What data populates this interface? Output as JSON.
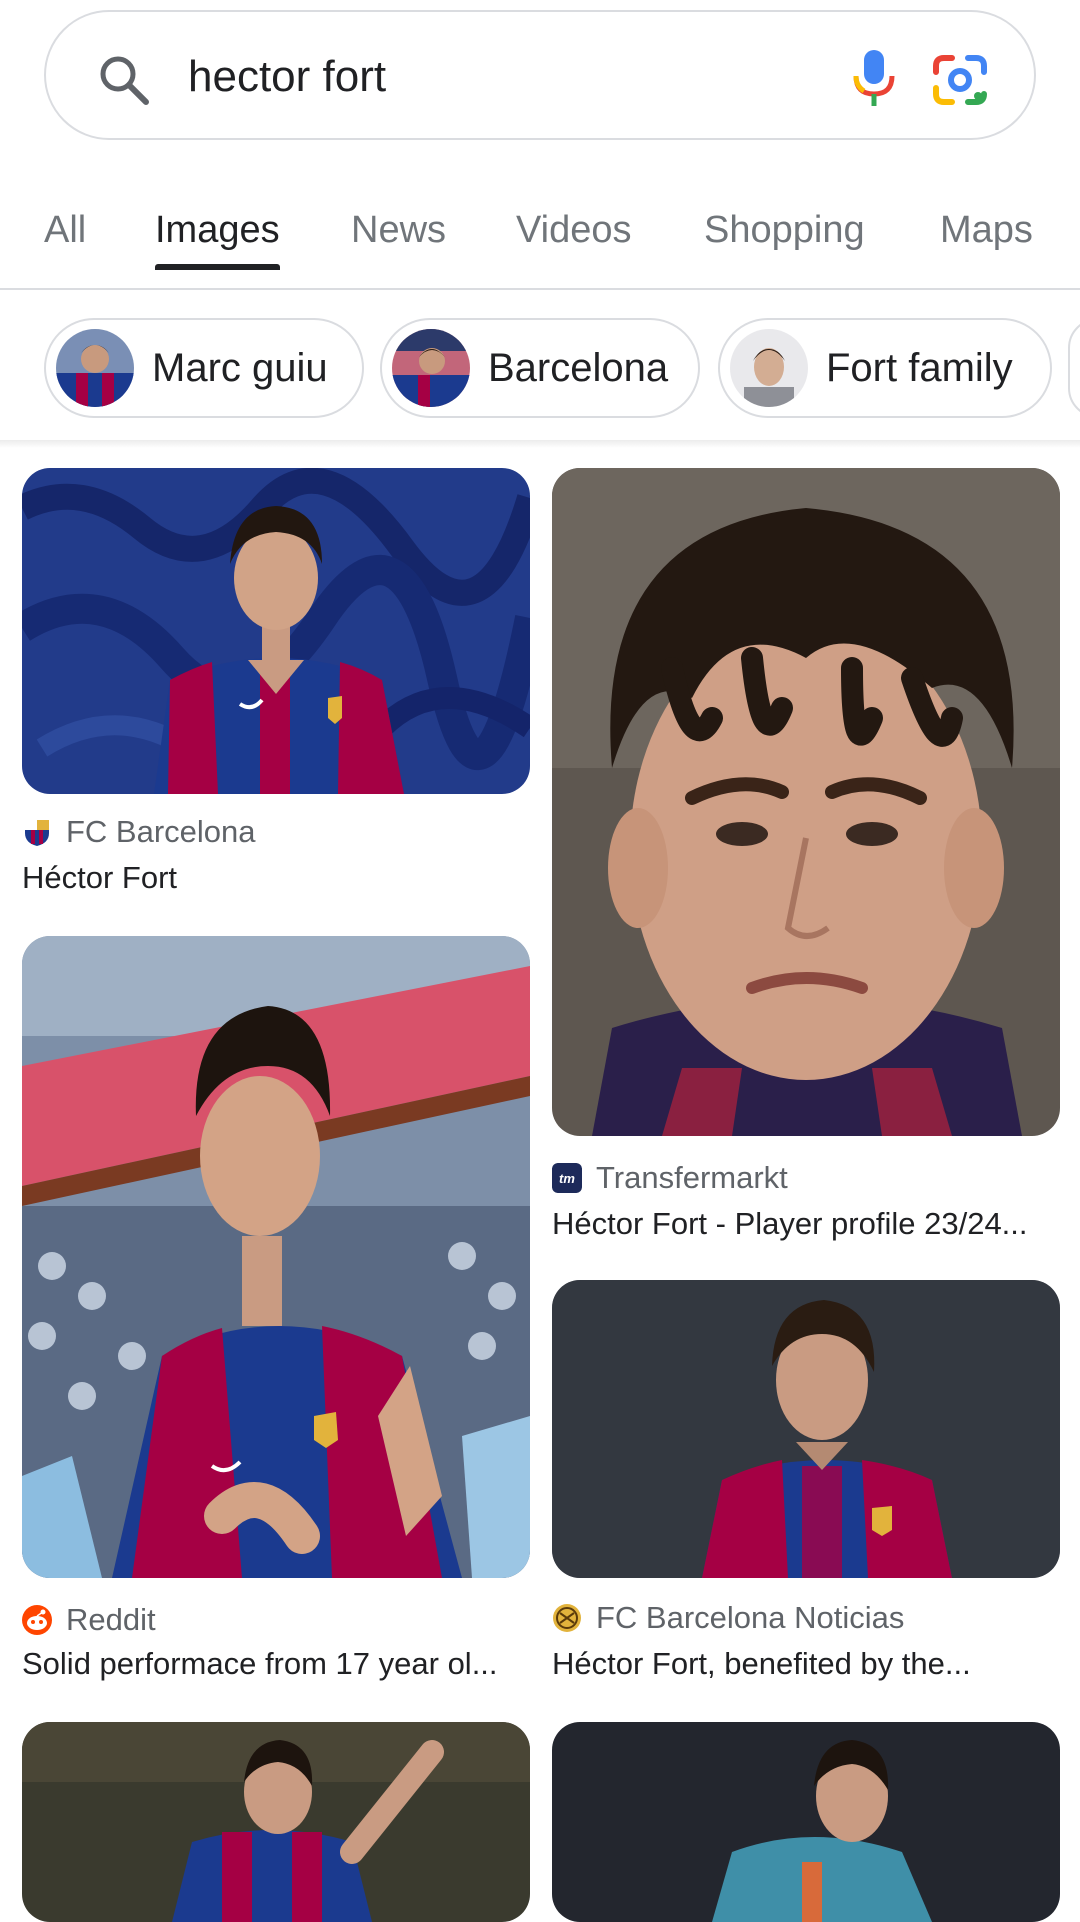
{
  "search": {
    "query": "hector fort"
  },
  "tabs": [
    {
      "label": "All",
      "active": false
    },
    {
      "label": "Images",
      "active": true
    },
    {
      "label": "News",
      "active": false
    },
    {
      "label": "Videos",
      "active": false
    },
    {
      "label": "Shopping",
      "active": false
    },
    {
      "label": "Maps",
      "active": false
    }
  ],
  "chips": [
    {
      "label": "Marc guiu"
    },
    {
      "label": "Barcelona"
    },
    {
      "label": "Fort family"
    }
  ],
  "results": [
    {
      "source": "FC Barcelona",
      "caption": "Héctor Fort"
    },
    {
      "source": "Transfermarkt",
      "caption": "Héctor Fort - Player profile 23/24..."
    },
    {
      "source": "Reddit",
      "caption": "Solid performace from 17 year ol..."
    },
    {
      "source": "FC Barcelona Noticias",
      "caption": "Héctor Fort, benefited by the..."
    }
  ],
  "colors": {
    "barca_blue": "#1b3a8f",
    "barca_red": "#a50044",
    "tab_active": "#202124",
    "tab_inactive": "#70757a",
    "reddit_orange": "#ff4500",
    "transfermarkt_navy": "#1d2a5a"
  }
}
